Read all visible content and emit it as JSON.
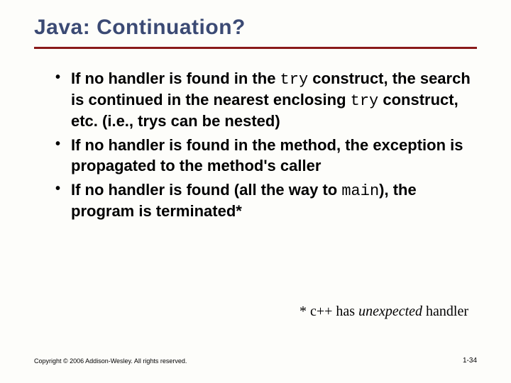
{
  "title": "Java: Continuation?",
  "bullets": [
    {
      "pre": "If no handler is found in the ",
      "code1": "try",
      "mid": " construct, the search is continued in the nearest enclosing ",
      "code2": "try",
      "post": " construct, etc. (i.e., trys can be nested)"
    },
    {
      "pre": "If no handler is found in the method, the exception is propagated to the method's caller",
      "code1": "",
      "mid": "",
      "code2": "",
      "post": ""
    },
    {
      "pre": "If no handler is found (all the way to ",
      "code1": "main",
      "mid": "), the program is terminated*",
      "code2": "",
      "post": ""
    }
  ],
  "footnote": {
    "pre": "* c++ has ",
    "em": "unexpected",
    "post": " handler"
  },
  "copyright": "Copyright © 2006 Addison-Wesley. All rights reserved.",
  "pagenum": "1-34"
}
